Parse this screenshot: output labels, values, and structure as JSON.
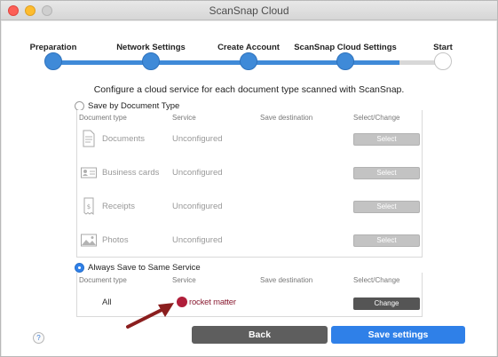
{
  "window": {
    "title": "ScanSnap Cloud"
  },
  "stepper": {
    "steps": [
      {
        "label": "Preparation",
        "state": "done"
      },
      {
        "label": "Network Settings",
        "state": "done"
      },
      {
        "label": "Create Account",
        "state": "done"
      },
      {
        "label": "ScanSnap Cloud Settings",
        "state": "current"
      },
      {
        "label": "Start",
        "state": "pending"
      }
    ]
  },
  "instruction": "Configure a cloud service for each document type scanned with ScanSnap.",
  "by_type": {
    "radio_label": "Save by Document Type",
    "selected": false,
    "headers": {
      "type": "Document type",
      "service": "Service",
      "destination": "Save destination",
      "action": "Select/Change"
    },
    "rows": [
      {
        "icon": "document-icon",
        "type": "Documents",
        "service": "Unconfigured",
        "button": "Select"
      },
      {
        "icon": "business-card-icon",
        "type": "Business cards",
        "service": "Unconfigured",
        "button": "Select"
      },
      {
        "icon": "receipt-icon",
        "type": "Receipts",
        "service": "Unconfigured",
        "button": "Select"
      },
      {
        "icon": "photo-icon",
        "type": "Photos",
        "service": "Unconfigured",
        "button": "Select"
      }
    ]
  },
  "same_service": {
    "radio_label": "Always Save to Same Service",
    "selected": true,
    "headers": {
      "type": "Document type",
      "service": "Service",
      "destination": "Save destination",
      "action": "Select/Change"
    },
    "row": {
      "type": "All",
      "service_logo_text": "rocket matter",
      "button": "Change"
    }
  },
  "footer": {
    "help": "?",
    "back": "Back",
    "save": "Save settings"
  },
  "colors": {
    "accent": "#2f80e8",
    "track": "#3f8ad8",
    "dark_button": "#555555",
    "logo": "#b01e3a"
  }
}
